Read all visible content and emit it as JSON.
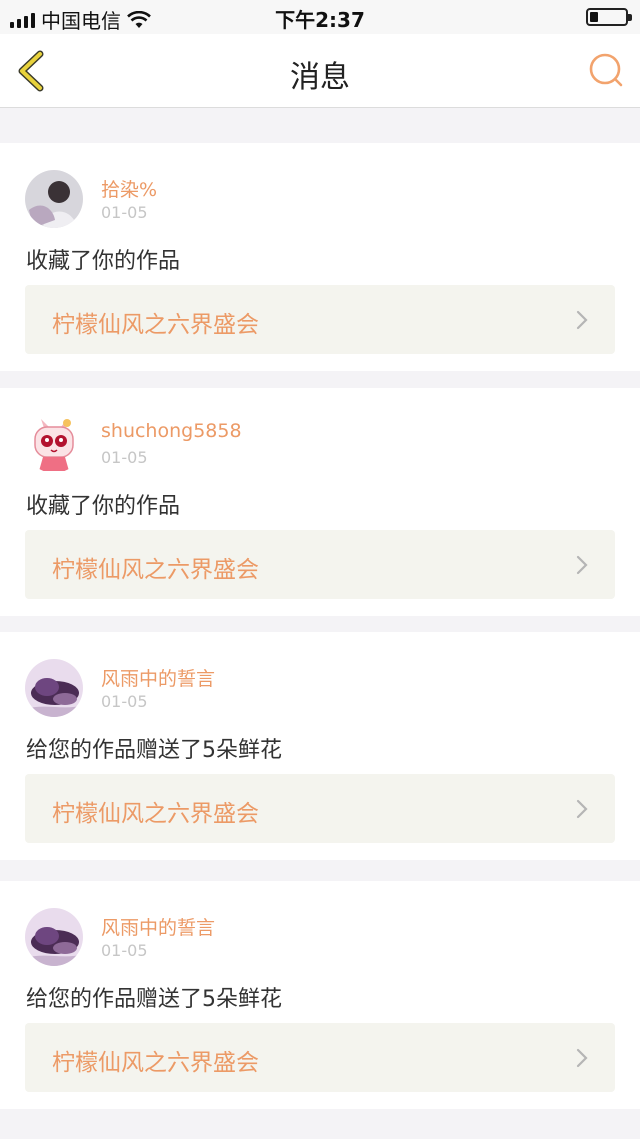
{
  "status_bar": {
    "carrier": "中国电信",
    "time": "下午2:37"
  },
  "header": {
    "title": "消息"
  },
  "messages": [
    {
      "user": "拾染%",
      "date": "01-05",
      "text": "收藏了你的作品",
      "work_title": "柠檬仙风之六界盛会"
    },
    {
      "user": "shuchong5858",
      "date": "01-05",
      "text": "收藏了你的作品",
      "work_title": "柠檬仙风之六界盛会"
    },
    {
      "user": "风雨中的誓言",
      "date": "01-05",
      "text": "给您的作品赠送了5朵鲜花",
      "work_title": "柠檬仙风之六界盛会"
    },
    {
      "user": "风雨中的誓言",
      "date": "01-05",
      "text": "给您的作品赠送了5朵鲜花",
      "work_title": "柠檬仙风之六界盛会"
    }
  ],
  "colors": {
    "accent": "#ec9a66",
    "back_icon": "#e8d23c",
    "card_link_bg": "#f4f4ee",
    "page_bg": "#f4f3f6"
  }
}
